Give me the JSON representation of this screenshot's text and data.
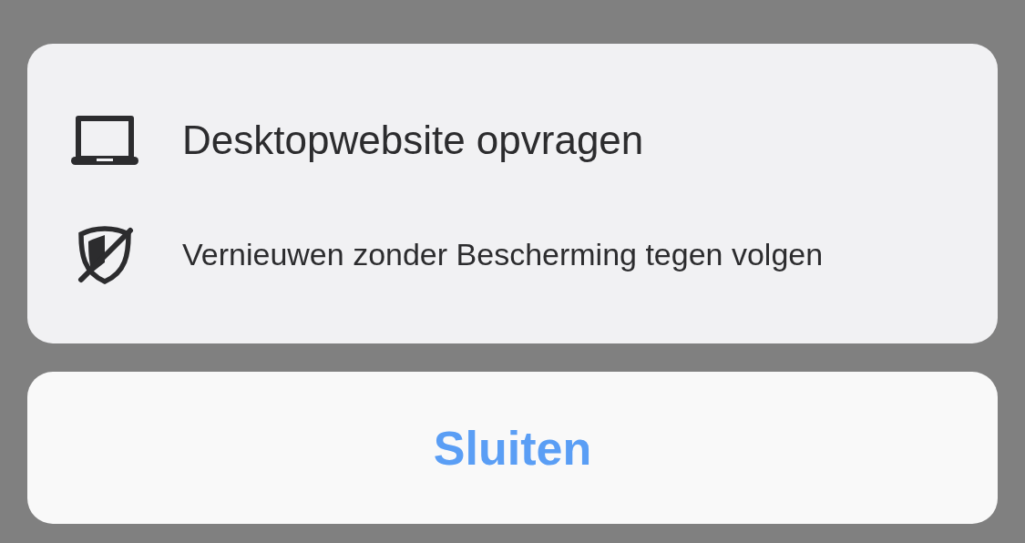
{
  "menu": {
    "items": [
      {
        "kind": "desktop",
        "label": "Desktopwebsite opvragen"
      },
      {
        "kind": "no-tracking",
        "label": "Vernieuwen zonder Bescherming tegen volgen"
      }
    ]
  },
  "close_button": {
    "label": "Sluiten"
  }
}
